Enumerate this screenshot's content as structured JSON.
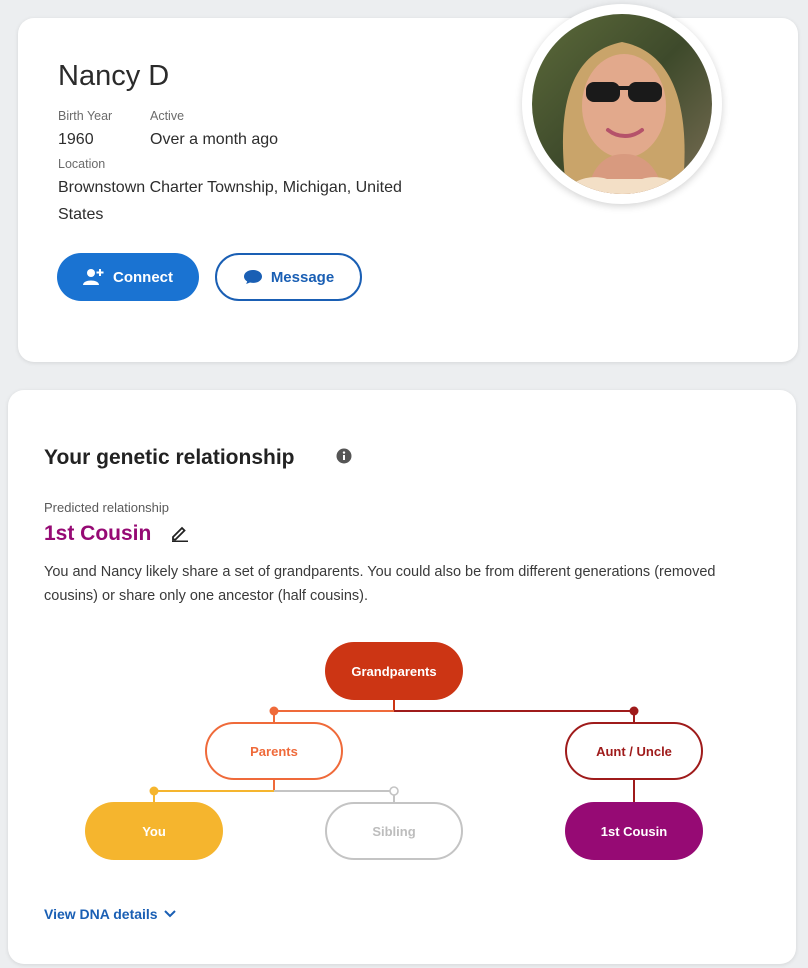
{
  "profile": {
    "name": "Nancy D",
    "birth_year_label": "Birth Year",
    "birth_year": "1960",
    "active_label": "Active",
    "active": "Over a month ago",
    "location_label": "Location",
    "location_line1": "Brownstown Charter Township, Michigan, United",
    "location_line2": "States",
    "connect_label": "Connect",
    "message_label": "Message"
  },
  "relationship": {
    "title": "Your genetic relationship",
    "predicted_label": "Predicted relationship",
    "predicted_value": "1st Cousin",
    "description": "You and Nancy likely share a set of grandparents. You could also be from different generations (removed cousins) or share only one ancestor (half cousins).",
    "tree": {
      "grandparents": "Grandparents",
      "parents": "Parents",
      "aunt_uncle": "Aunt / Uncle",
      "you": "You",
      "sibling": "Sibling",
      "cousin": "1st Cousin"
    },
    "view_details": "View DNA details"
  },
  "colors": {
    "primary_blue": "#1a73d2",
    "grandparents": "#cc3514",
    "parents": "#ef6a3a",
    "aunt_uncle": "#9f1b1b",
    "you": "#f5b52e",
    "sibling": "#c4c4c4",
    "cousin": "#960a74"
  },
  "icons": {
    "connect": "add-person-icon",
    "message": "chat-bubble-icon",
    "info": "info-icon",
    "edit": "pencil-icon",
    "expand": "chevron-down-icon"
  }
}
